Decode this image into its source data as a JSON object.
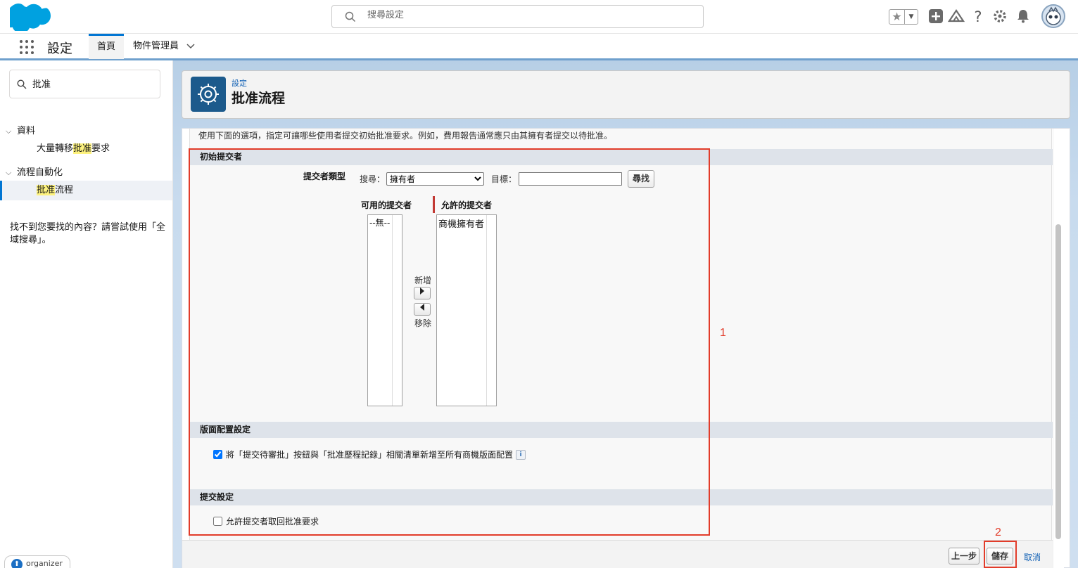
{
  "header": {
    "search_placeholder": "搜尋設定"
  },
  "context_bar": {
    "app_name": "設定",
    "tabs": [
      {
        "label": "首頁"
      },
      {
        "label": "物件管理員"
      }
    ]
  },
  "sidebar": {
    "quick_find_value": "批准",
    "nodes": [
      {
        "label": "資料",
        "children": [
          {
            "prefix": "大量轉移",
            "highlight": "批准",
            "suffix": "要求"
          }
        ]
      },
      {
        "label": "流程自動化",
        "children": [
          {
            "prefix": "",
            "highlight": "批准",
            "suffix": "流程"
          }
        ]
      }
    ],
    "not_found_text": "找不到您要找的內容？請嘗試使用「全域搜尋」。",
    "organizer_label": "organizer"
  },
  "page_header": {
    "breadcrumb": "設定",
    "title": "批准流程",
    "icon": "gear-icon"
  },
  "main": {
    "intro": "使用下面的選項，指定可讓哪些使用者提交初始批准要求。例如，費用報告通常應只由其擁有者提交以待批准。",
    "initial_submitters": {
      "section_title": "初始提交者",
      "submitter_type_label": "提交者類型",
      "search_label": "搜尋：",
      "search_selected": "擁有者",
      "target_label": "目標：",
      "target_value": "",
      "find_button": "尋找",
      "available_label": "可用的提交者",
      "available_items": [
        "--無--"
      ],
      "allowed_label": "允許的提交者",
      "allowed_items": [
        "商機擁有者"
      ],
      "add_label": "新增",
      "remove_label": "移除"
    },
    "layout_settings": {
      "section_title": "版面配置設定",
      "checkbox_label": "將「提交待審批」按鈕與「批准歷程記錄」相關清單新增至所有商機版面配置",
      "checked": true
    },
    "submission_settings": {
      "section_title": "提交設定",
      "checkbox_label": "允許提交者取回批准要求",
      "checked": false
    },
    "footer": {
      "previous_button": "上一步",
      "save_button": "儲存",
      "cancel_link": "取消"
    }
  },
  "annotations": {
    "box1_label": "1",
    "box2_label": "2",
    "color": "#e23c2a"
  },
  "colors": {
    "brand_blue": "#0176d3",
    "header_icon_bg": "#1c5a8c",
    "section_header_bg": "#dee3ea"
  }
}
